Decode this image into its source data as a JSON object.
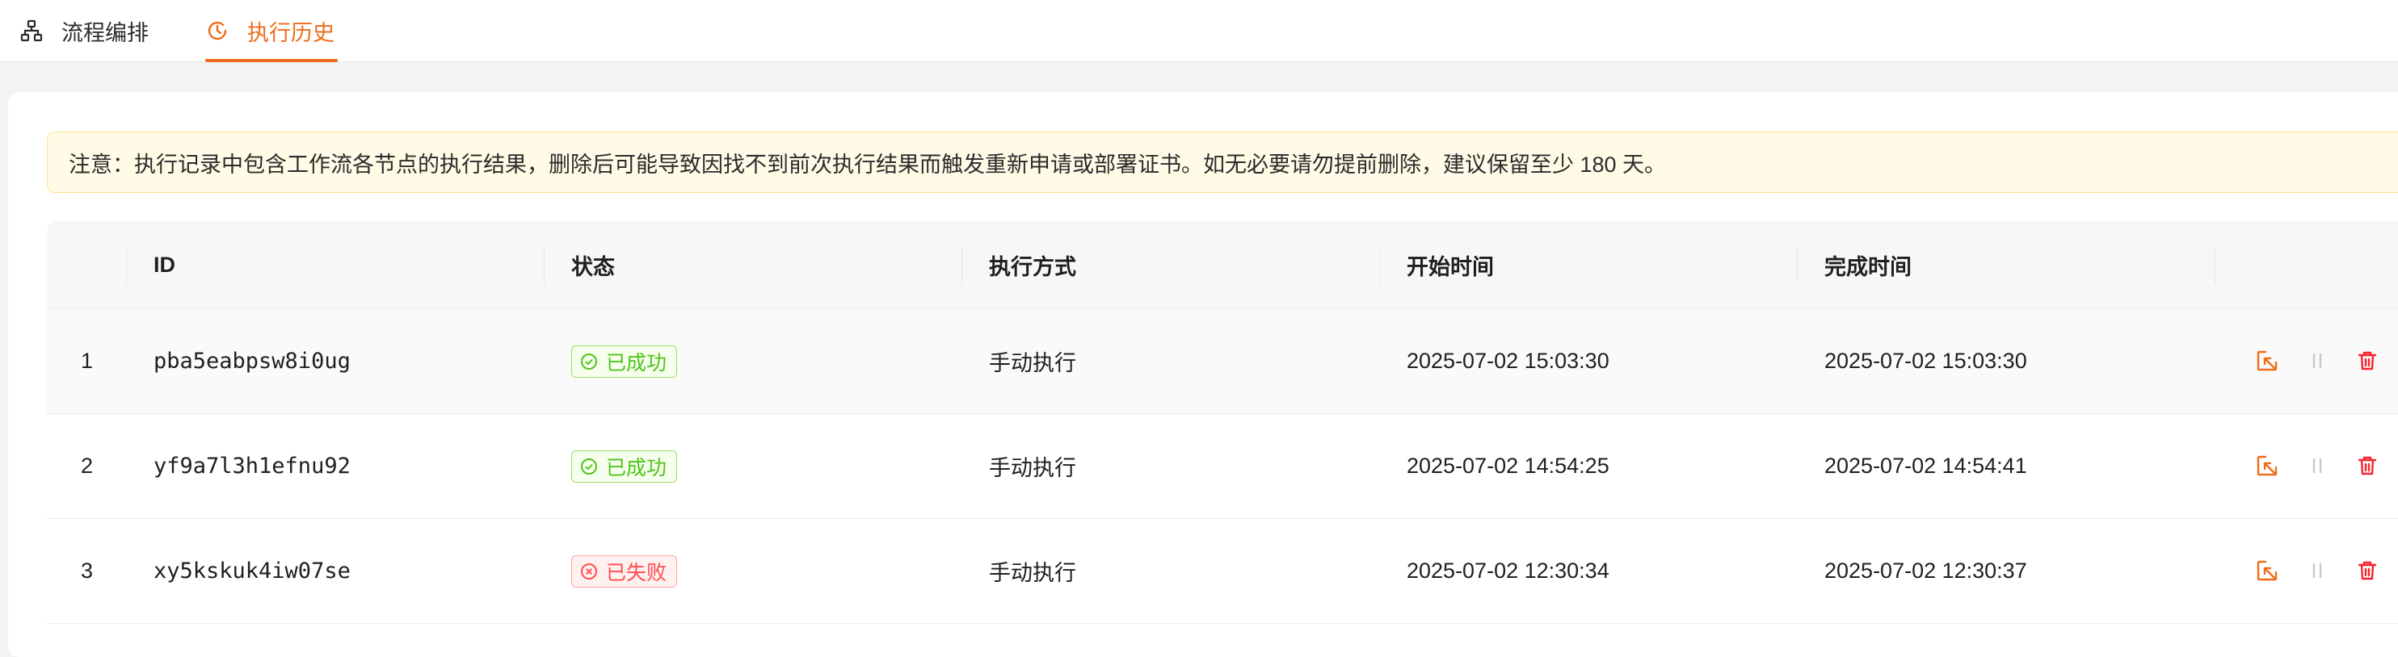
{
  "tabs": [
    {
      "label": "流程编排",
      "icon": "workflow-icon",
      "active": false
    },
    {
      "label": "执行历史",
      "icon": "history-icon",
      "active": true
    }
  ],
  "notice": {
    "text": "注意：执行记录中包含工作流各节点的执行结果，删除后可能导致因找不到前次执行结果而触发重新申请或部署证书。如无必要请勿提前删除，建议保留至少 180 天。"
  },
  "table": {
    "columns": [
      "",
      "ID",
      "状态",
      "执行方式",
      "开始时间",
      "完成时间",
      ""
    ],
    "rows": [
      {
        "index": "1",
        "id": "pba5eabpsw8i0ug",
        "status": "已成功",
        "status_type": "success",
        "mode": "手动执行",
        "start": "2025-07-02 15:03:30",
        "end": "2025-07-02 15:03:30"
      },
      {
        "index": "2",
        "id": "yf9a7l3h1efnu92",
        "status": "已成功",
        "status_type": "success",
        "mode": "手动执行",
        "start": "2025-07-02 14:54:25",
        "end": "2025-07-02 14:54:41"
      },
      {
        "index": "3",
        "id": "xy5kskuk4iw07se",
        "status": "已失败",
        "status_type": "fail",
        "mode": "手动执行",
        "start": "2025-07-02 12:30:34",
        "end": "2025-07-02 12:30:37"
      }
    ],
    "actions": [
      "view-detail-icon",
      "cancel-icon",
      "delete-icon"
    ]
  },
  "colors": {
    "accent": "#ef6c1a",
    "success": "#52c41a",
    "fail": "#ff4d4f",
    "delete": "#f5222d",
    "disabled": "#c8c8c8"
  }
}
